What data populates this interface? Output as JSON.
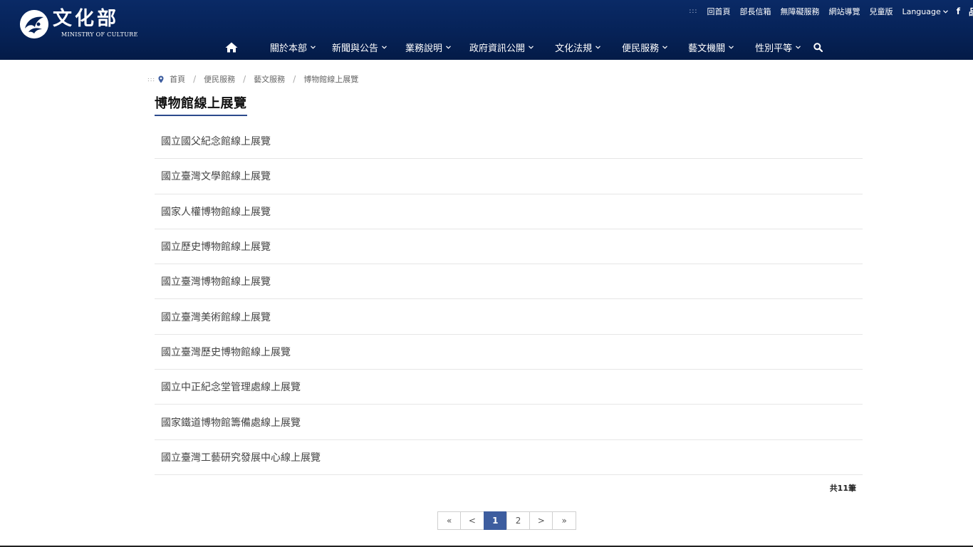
{
  "brand": {
    "name": "文化部",
    "subtitle": "MINISTRY OF CULTURE"
  },
  "utility_links": {
    "dots": ":::",
    "home": "回首頁",
    "minister_mailbox": "部長信箱",
    "accessibility": "無障礙服務",
    "sitemap": "網站導覽",
    "kids": "兒童版",
    "language": "Language",
    "facebook": "f",
    "extra": "品"
  },
  "nav": {
    "items": [
      {
        "label": "關於本部"
      },
      {
        "label": "新聞與公告"
      },
      {
        "label": "業務說明"
      },
      {
        "label": "政府資訊公開"
      },
      {
        "label": "文化法規"
      },
      {
        "label": "便民服務"
      },
      {
        "label": "藝文機關"
      },
      {
        "label": "性別平等"
      }
    ]
  },
  "breadcrumb": {
    "dots": ":::",
    "home": "首頁",
    "level1": "便民服務",
    "level2": "藝文服務",
    "current": "博物館線上展覽"
  },
  "page_title": "博物館線上展覽",
  "list_items": [
    "國立國父紀念館線上展覽",
    "國立臺灣文學館線上展覽",
    "國家人權博物館線上展覽",
    "國立歷史博物館線上展覽",
    "國立臺灣博物館線上展覽",
    "國立臺灣美術館線上展覽",
    "國立臺灣歷史博物館線上展覽",
    "國立中正紀念堂管理處線上展覽",
    "國家鐵道博物館籌備處線上展覽",
    "國立臺灣工藝研究發展中心線上展覽"
  ],
  "total_text": "共11筆",
  "pagination": {
    "first": "«",
    "prev": "<",
    "pages": [
      "1",
      "2"
    ],
    "current_page": "1",
    "next": ">",
    "last": "»"
  },
  "colors": {
    "header_bg": "#062257",
    "accent": "#2c4b8c",
    "pager_active": "#3d5d9f"
  }
}
